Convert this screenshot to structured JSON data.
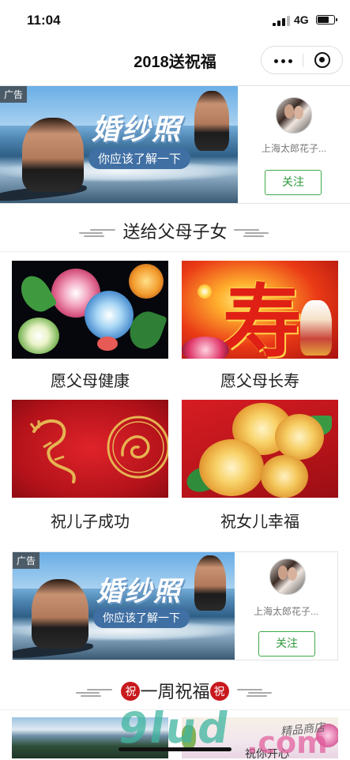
{
  "status_bar": {
    "time": "11:04",
    "network": "4G"
  },
  "nav": {
    "title": "2018送祝福",
    "more_icon": "more-dots-icon",
    "close_icon": "target-circle-icon"
  },
  "ads": [
    {
      "tag": "广告",
      "headline": "婚纱照",
      "pill": "你应该了解一下",
      "account": "上海太郎花子...",
      "follow": "关注"
    },
    {
      "tag": "广告",
      "headline": "婚纱照",
      "pill": "你应该了解一下",
      "account": "上海太郎花子...",
      "follow": "关注"
    }
  ],
  "sections": [
    {
      "title": "送给父母子女"
    },
    {
      "title": "一周祝福",
      "badge": "祝"
    }
  ],
  "cards": [
    {
      "label": "愿父母健康",
      "image": "peony-embroidery"
    },
    {
      "label": "愿父母长寿",
      "image": "longevity-character",
      "image_text": "寿"
    },
    {
      "label": "祝儿子成功",
      "image": "golden-dragon-red"
    },
    {
      "label": "祝女儿幸福",
      "image": "yellow-peonies-red"
    }
  ],
  "bottom_preview": {
    "right_caption": "祝你开心"
  },
  "watermark": {
    "text": "9lud",
    "suffix": ".com",
    "shop": "精品商店"
  },
  "colors": {
    "accent_green": "#3daa48",
    "festive_red": "#c8191d",
    "gold": "#e3b33a"
  }
}
